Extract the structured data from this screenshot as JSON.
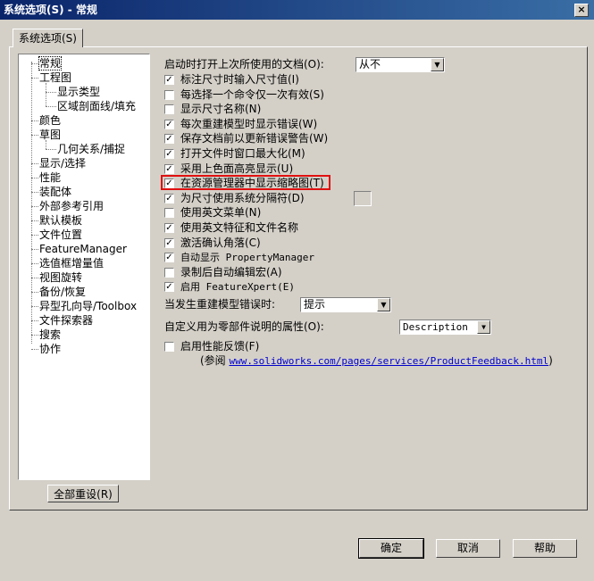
{
  "window": {
    "title": "系统选项(S) - 常规",
    "close_label": "×"
  },
  "tab": {
    "label": "系统选项(S)"
  },
  "tree": [
    {
      "label": "常规",
      "level": 0
    },
    {
      "label": "工程图",
      "level": 0
    },
    {
      "label": "显示类型",
      "level": 1
    },
    {
      "label": "区域剖面线/填充",
      "level": 1
    },
    {
      "label": "颜色",
      "level": 0
    },
    {
      "label": "草图",
      "level": 0
    },
    {
      "label": "几何关系/捕捉",
      "level": 1
    },
    {
      "label": "显示/选择",
      "level": 0
    },
    {
      "label": "性能",
      "level": 0
    },
    {
      "label": "装配体",
      "level": 0
    },
    {
      "label": "外部参考引用",
      "level": 0
    },
    {
      "label": "默认模板",
      "level": 0
    },
    {
      "label": "文件位置",
      "level": 0
    },
    {
      "label": "FeatureManager",
      "level": 0
    },
    {
      "label": "选值框增量值",
      "level": 0
    },
    {
      "label": "视图旋转",
      "level": 0
    },
    {
      "label": "备份/恢复",
      "level": 0
    },
    {
      "label": "异型孔向导/Toolbox",
      "level": 0
    },
    {
      "label": "文件探索器",
      "level": 0
    },
    {
      "label": "搜索",
      "level": 0
    },
    {
      "label": "协作",
      "level": 0
    }
  ],
  "reset_label": "全部重设(R)",
  "open_last": {
    "label": "启动时打开上次所使用的文档(O):",
    "value": "从不"
  },
  "options": [
    {
      "label": "标注尺寸时输入尺寸值(I)",
      "checked": true
    },
    {
      "label": "每选择一个命令仅一次有效(S)",
      "checked": false
    },
    {
      "label": "显示尺寸名称(N)",
      "checked": false
    },
    {
      "label": "每次重建模型时显示错误(W)",
      "checked": true
    },
    {
      "label": "保存文档前以更新错误警告(W)",
      "checked": true
    },
    {
      "label": "打开文件时窗口最大化(M)",
      "checked": true
    },
    {
      "label": "采用上色面高亮显示(U)",
      "checked": true
    },
    {
      "label": "在资源管理器中显示缩略图(T)",
      "checked": true
    },
    {
      "label": "为尺寸使用系统分隔符(D)",
      "checked": true
    },
    {
      "label": "使用英文菜单(N)",
      "checked": false
    },
    {
      "label": "使用英文特征和文件名称",
      "checked": true
    },
    {
      "label": "激活确认角落(C)",
      "checked": true
    },
    {
      "label": "自动显示 PropertyManager",
      "checked": true
    },
    {
      "label": "录制后自动编辑宏(A)",
      "checked": false
    },
    {
      "label": "启用 FeatureXpert(E)",
      "checked": true
    }
  ],
  "rebuild_error": {
    "label": "当发生重建模型错误时:",
    "value": "提示"
  },
  "custom_prop": {
    "label": "自定义用为零部件说明的属性(O):",
    "value": "Description"
  },
  "feedback": {
    "label": "启用性能反馈(F)",
    "checked": false,
    "ref_prefix": "(参阅 ",
    "link": "www.solidworks.com/pages/services/ProductFeedback.html",
    "ref_suffix": ")"
  },
  "buttons": {
    "ok": "确定",
    "cancel": "取消",
    "help": "帮助"
  }
}
